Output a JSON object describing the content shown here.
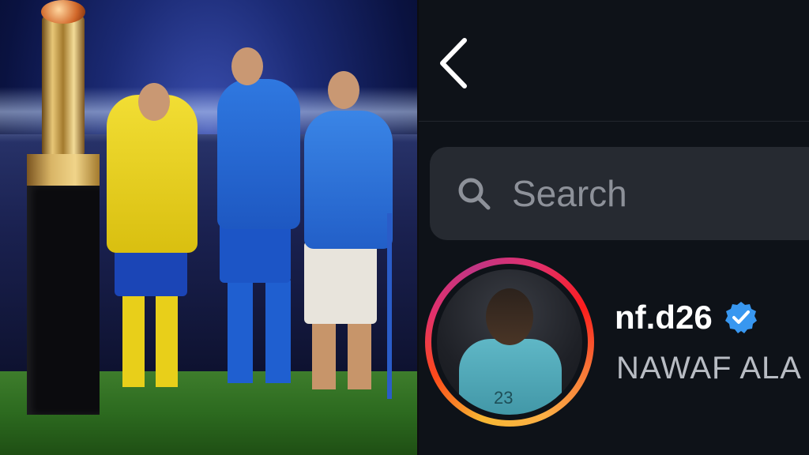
{
  "photo": {
    "image_label": "Football players celebrating beside a trophy"
  },
  "header": {
    "back_icon": "chevron-left-icon"
  },
  "search": {
    "placeholder": "Search",
    "icon": "search-icon"
  },
  "results": [
    {
      "username": "nf.d26",
      "full_name": "NAWAF ALA",
      "verified": true,
      "story_ring": true,
      "avatar_jersey_number": "23"
    }
  ],
  "colors": {
    "app_background": "#0e1218",
    "search_background": "#262a31",
    "verified_badge": "#3897f0",
    "story_ring": [
      "#f7b733",
      "#fc4a1a",
      "#e1306c",
      "#c13584"
    ]
  }
}
